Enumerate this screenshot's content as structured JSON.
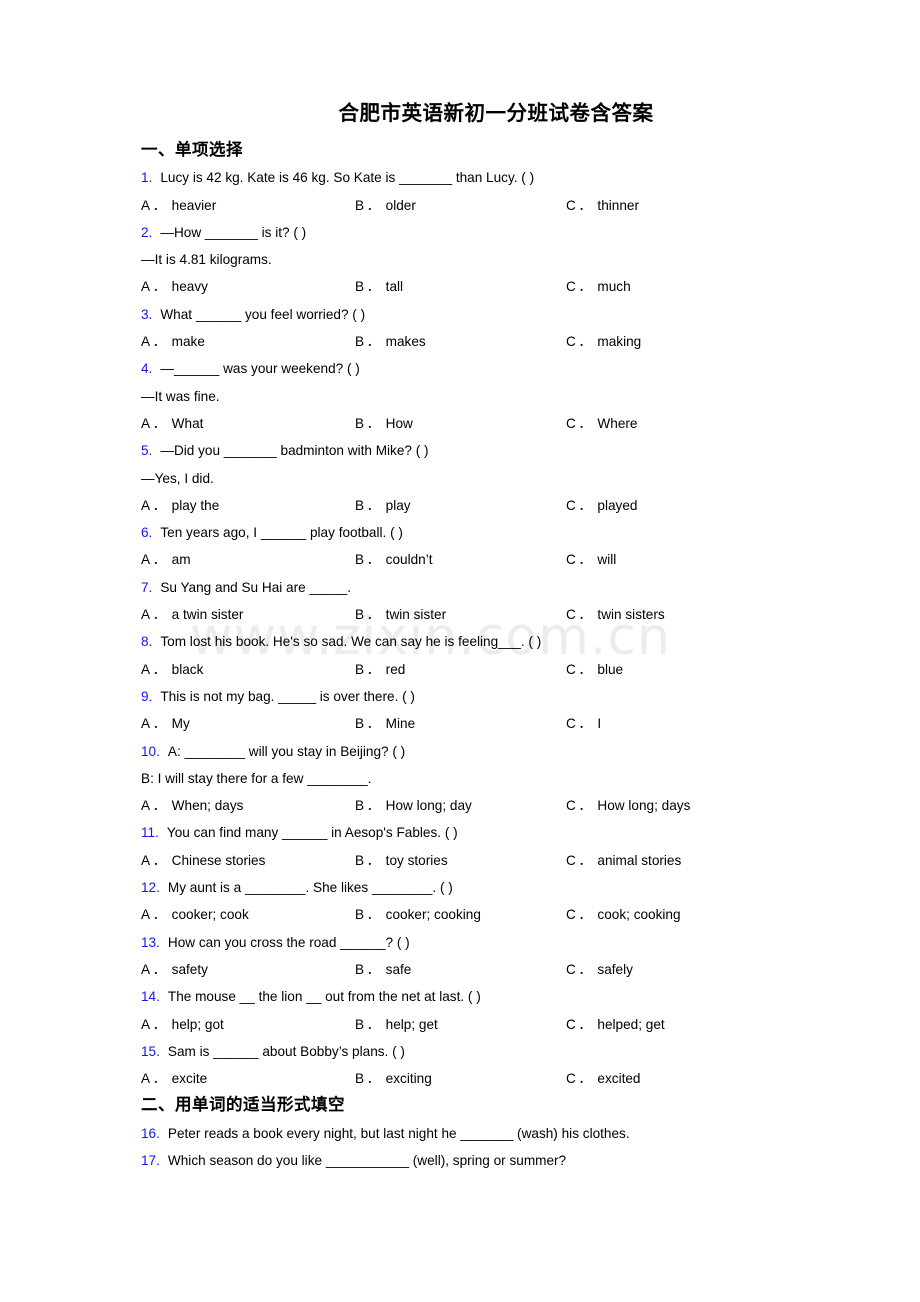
{
  "document": {
    "title": "合肥市英语新初一分班试卷含答案",
    "watermark": "www.zixin.com.cn",
    "accent_number_color": "#1515f0",
    "watermark_color": "#ececec"
  },
  "sections": [
    {
      "heading": "一、单项选择"
    },
    {
      "heading": "二、用单词的适当形式填空"
    }
  ],
  "questions": [
    {
      "num": "1.",
      "text": "Lucy is 42 kg. Kate is 46 kg. So Kate is _______ than Lucy. (    )",
      "options": {
        "a_label": "A．",
        "a": "heavier",
        "b_label": "B．",
        "b": "older",
        "c_label": "C．",
        "c": "thinner"
      }
    },
    {
      "num": "2.",
      "text": "—How _______ is it? (  )",
      "cont": "—It is 4.81 kilograms.",
      "options": {
        "a_label": "A．",
        "a": "heavy",
        "b_label": "B．",
        "b": "tall",
        "c_label": "C．",
        "c": "much"
      }
    },
    {
      "num": "3.",
      "text": "What ______ you feel worried? (  )",
      "options": {
        "a_label": "A．",
        "a": "make",
        "b_label": "B．",
        "b": "makes",
        "c_label": "C．",
        "c": "making"
      }
    },
    {
      "num": "4.",
      "text": "—______ was your weekend? (   )",
      "cont": "—It was fine.",
      "options": {
        "a_label": "A．",
        "a": "What",
        "b_label": "B．",
        "b": "How",
        "c_label": "C．",
        "c": "Where"
      }
    },
    {
      "num": "5.",
      "text": "—Did you _______ badminton with Mike? (  )",
      "cont": "—Yes, I did.",
      "options": {
        "a_label": "A．",
        "a": "play the",
        "b_label": "B．",
        "b": "play",
        "c_label": "C．",
        "c": "played"
      }
    },
    {
      "num": "6.",
      "text": "Ten years ago, I ______ play football. (   )",
      "options": {
        "a_label": "A．",
        "a": "am",
        "b_label": "B．",
        "b": "couldn’t",
        "c_label": "C．",
        "c": "will"
      }
    },
    {
      "num": "7.",
      "text": "Su Yang and Su Hai are _____.",
      "options": {
        "a_label": "A．",
        "a": "a twin sister",
        "b_label": "B．",
        "b": "twin sister",
        "c_label": "C．",
        "c": "twin sisters"
      }
    },
    {
      "num": "8.",
      "text": "Tom lost his book. He's so sad. We can say he is feeling___.  (   )",
      "options": {
        "a_label": "A．",
        "a": "black",
        "b_label": "B．",
        "b": "red",
        "c_label": "C．",
        "c": "blue"
      }
    },
    {
      "num": "9.",
      "text": "This is not my bag. _____ is over there. (  )",
      "options": {
        "a_label": "A．",
        "a": "My",
        "b_label": "B．",
        "b": "Mine",
        "c_label": "C．",
        "c": "I"
      }
    },
    {
      "num": "10.",
      "text": "A: ________ will you stay in Beijing? (   )",
      "cont": "B: I will stay there for a few ________.",
      "options": {
        "a_label": "A．",
        "a": "When; days",
        "b_label": "B．",
        "b": "How long; day",
        "c_label": "C．",
        "c": "How long; days"
      }
    },
    {
      "num": "11.",
      "text": "You can find many ______ in Aesop's Fables. (  )",
      "options": {
        "a_label": "A．",
        "a": "Chinese stories",
        "b_label": "B．",
        "b": "toy stories",
        "c_label": "C．",
        "c": "animal stories"
      }
    },
    {
      "num": "12.",
      "text": "My aunt is a ________. She likes ________. (   )",
      "options": {
        "a_label": "A．",
        "a": "cooker; cook",
        "b_label": "B．",
        "b": "cooker; cooking",
        "c_label": "C．",
        "c": "cook; cooking"
      }
    },
    {
      "num": "13.",
      "text": "How can you cross the road ______?    ( )",
      "options": {
        "a_label": "A．",
        "a": "safety",
        "b_label": "B．",
        "b": "safe",
        "c_label": "C．",
        "c": "safely"
      }
    },
    {
      "num": "14.",
      "text": "The mouse __ the lion __ out from the net at last. ( )",
      "options": {
        "a_label": "A．",
        "a": "help; got",
        "b_label": "B．",
        "b": "help; get",
        "c_label": "C．",
        "c": "helped; get"
      }
    },
    {
      "num": "15.",
      "text": "Sam is ______ about Bobby’s plans. (  )",
      "options": {
        "a_label": "A．",
        "a": "excite",
        "b_label": "B．",
        "b": "exciting",
        "c_label": "C．",
        "c": "excited"
      }
    },
    {
      "num": "16.",
      "text": "Peter reads a book every night, but last night he _______ (wash) his clothes."
    },
    {
      "num": "17.",
      "text": "Which season do you like ___________ (well), spring or summer?"
    }
  ]
}
